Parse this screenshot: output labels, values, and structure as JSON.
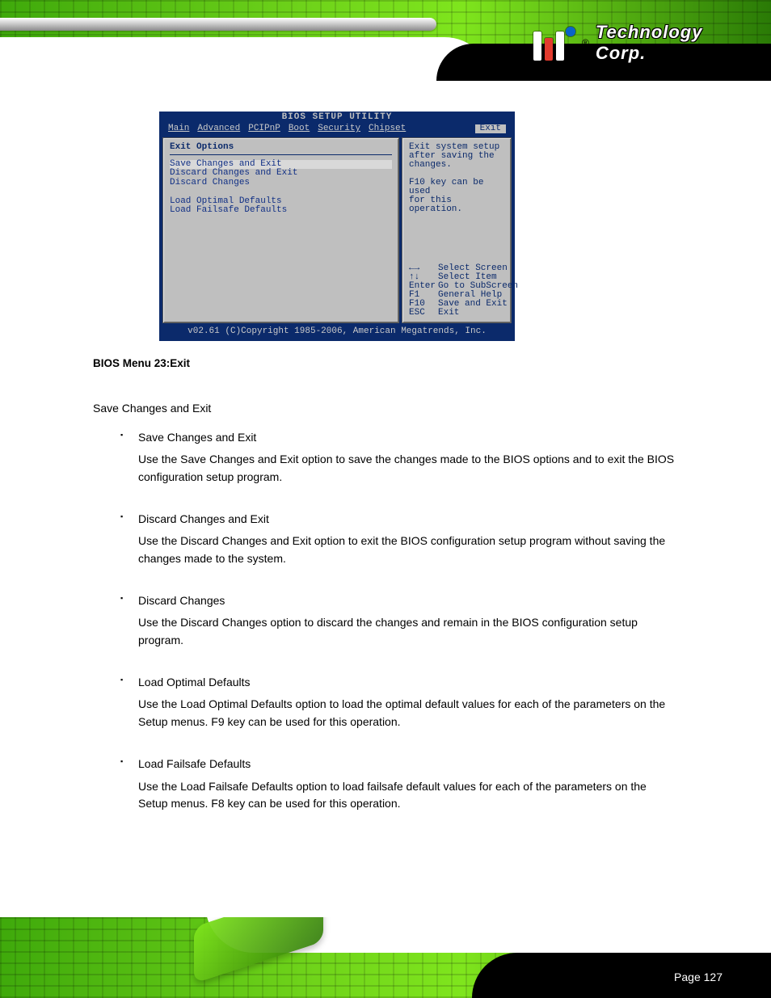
{
  "brand": {
    "name_prefix": "Technology Corp",
    "name_suffix": ".",
    "reg": "®"
  },
  "bios": {
    "title": "BIOS SETUP UTILITY",
    "tabs": [
      "Main",
      "Advanced",
      "PCIPnP",
      "Boot",
      "Security",
      "Chipset",
      "Exit"
    ],
    "active_tab_index": 6,
    "left_heading": "Exit Options",
    "items": [
      "Save Changes and Exit",
      "Discard Changes and Exit",
      "Discard Changes",
      "",
      "Load Optimal Defaults",
      "Load Failsafe Defaults"
    ],
    "help_top": [
      "Exit system setup",
      "after saving the",
      "changes.",
      "",
      "F10 key can be used",
      "for this operation."
    ],
    "key_hints": [
      {
        "k": "←→",
        "d": "Select Screen"
      },
      {
        "k": "↑↓",
        "d": "Select Item"
      },
      {
        "k": "Enter",
        "d": "Go to SubScreen"
      },
      {
        "k": "F1",
        "d": "General Help"
      },
      {
        "k": "F10",
        "d": "Save and Exit"
      },
      {
        "k": "ESC",
        "d": "Exit"
      }
    ],
    "footer": "v02.61 (C)Copyright 1985-2006, American Megatrends, Inc."
  },
  "doc": {
    "fig_caption": "BIOS Menu 23:Exit",
    "section_heading": "Save Changes and Exit",
    "options": [
      {
        "name": "Save Changes and Exit",
        "desc": "Use the Save Changes and Exit option to save the changes made to the BIOS options and to exit the BIOS configuration setup program."
      },
      {
        "name": "Discard Changes and Exit",
        "desc": "Use the Discard Changes and Exit option to exit the BIOS configuration setup program without saving the changes made to the system."
      },
      {
        "name": "Discard Changes",
        "desc": "Use the Discard Changes option to discard the changes and remain in the BIOS configuration setup program."
      },
      {
        "name": "Load Optimal Defaults",
        "desc": "Use the Load Optimal Defaults option to load the optimal default values for each of the parameters on the Setup menus. F9 key can be used for this operation."
      },
      {
        "name": "Load Failsafe Defaults",
        "desc": "Use the Load Failsafe Defaults option to load failsafe default values for each of the parameters on the Setup menus. F8 key can be used for this operation."
      }
    ]
  },
  "page_number": "Page 127"
}
